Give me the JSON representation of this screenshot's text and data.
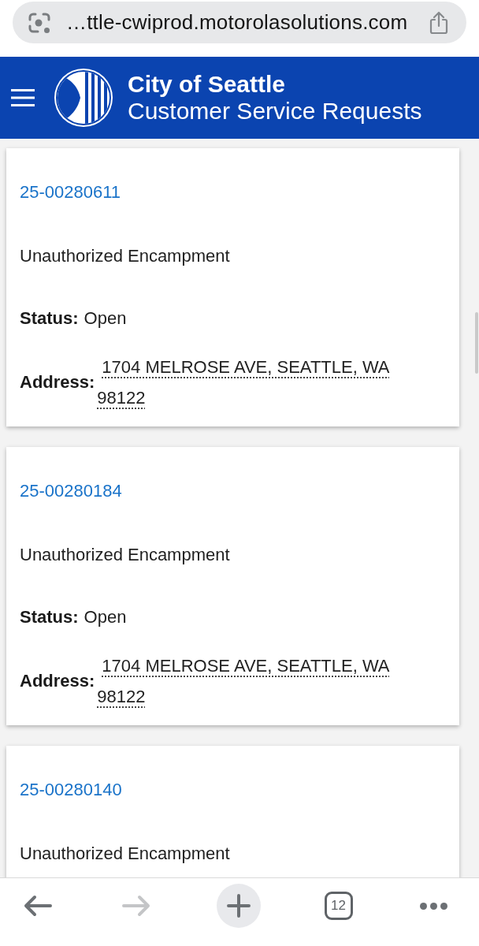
{
  "browser": {
    "url": "…ttle-cwiprod.motorolasolutions.com"
  },
  "header": {
    "title": "City of Seattle",
    "subtitle": "Customer Service Requests"
  },
  "requests": [
    {
      "id": "25-00280611",
      "type": "Unauthorized Encampment",
      "fields": [
        {
          "kind": "status",
          "label": "Status:",
          "value": "Open"
        },
        {
          "kind": "address",
          "label": "Address:",
          "value": "1704 MELROSE AVE, SEATTLE, WA 98122"
        }
      ]
    },
    {
      "id": "25-00280184",
      "type": "Unauthorized Encampment",
      "fields": [
        {
          "kind": "status",
          "label": "Status:",
          "value": "Open"
        },
        {
          "kind": "address",
          "label": "Address:",
          "value": "1704 MELROSE AVE, SEATTLE, WA 98122"
        }
      ]
    },
    {
      "id": "25-00280140",
      "type": "Unauthorized Encampment"
    }
  ],
  "toolbar": [
    {
      "kind": "back",
      "disabled": false
    },
    {
      "kind": "forward",
      "disabled": true
    },
    {
      "kind": "new_tab",
      "disabled": false
    },
    {
      "kind": "tabs",
      "label": "12",
      "disabled": false
    },
    {
      "kind": "more",
      "disabled": false
    }
  ]
}
